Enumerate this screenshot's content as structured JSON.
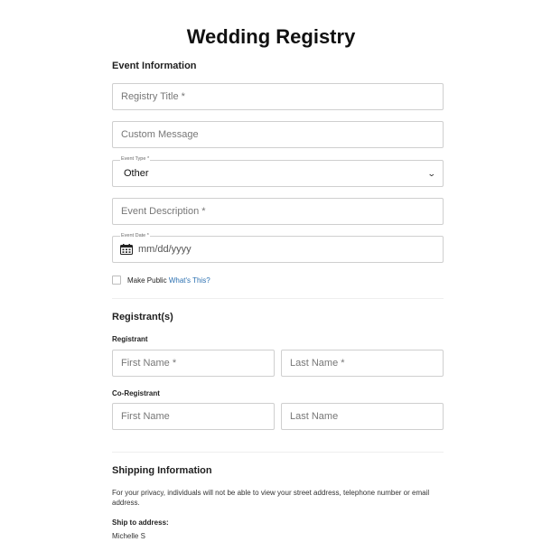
{
  "page_title": "Wedding Registry",
  "event_section": {
    "heading": "Event Information",
    "registry_title_placeholder": "Registry Title *",
    "custom_message_placeholder": "Custom Message",
    "event_type_label": "Event Type *",
    "event_type_value": "Other",
    "event_description_placeholder": "Event Description *",
    "event_date_label": "Event Date *",
    "event_date_placeholder": "mm/dd/yyyy",
    "make_public_label": "Make Public",
    "whats_this_link": "What's This?"
  },
  "registrants_section": {
    "heading": "Registrant(s)",
    "registrant_label": "Registrant",
    "registrant_first_placeholder": "First Name *",
    "registrant_last_placeholder": "Last Name *",
    "co_registrant_label": "Co-Registrant",
    "co_first_placeholder": "First Name",
    "co_last_placeholder": "Last Name"
  },
  "shipping_section": {
    "heading": "Shipping Information",
    "privacy_note": "For your privacy, individuals will not be able to view your street address, telephone number or email address.",
    "ship_to_label": "Ship to address:",
    "ship_to_name": "Michelle S"
  },
  "colors": {
    "link": "#2a6fb0",
    "border": "#cfcfcf"
  },
  "icons": {
    "date_field": "calendar-icon",
    "select_field": "chevron-down-icon"
  }
}
